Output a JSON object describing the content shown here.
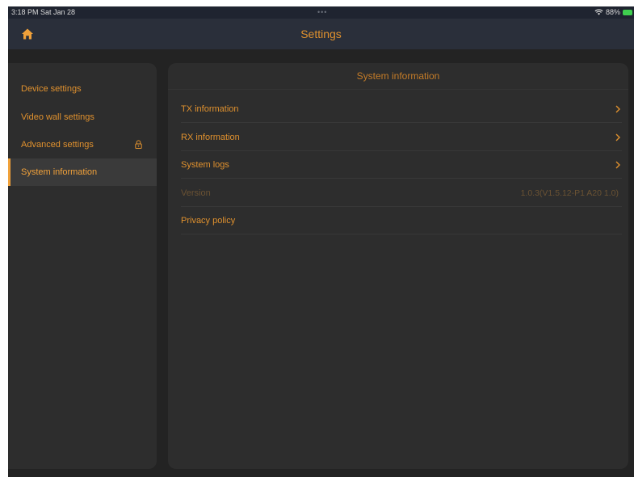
{
  "status_bar": {
    "time_date": "3:18 PM  Sat Jan 28",
    "dots": "•••",
    "battery": "88%"
  },
  "nav": {
    "title": "Settings",
    "home_icon": "home-icon"
  },
  "sidebar": {
    "items": [
      {
        "label": "Device settings"
      },
      {
        "label": "Video wall settings"
      },
      {
        "label": "Advanced settings",
        "icon": "lock-icon"
      },
      {
        "label": "System information",
        "active": true
      }
    ]
  },
  "panel": {
    "header": "System information",
    "rows": [
      {
        "label": "TX information",
        "icon": "chevron-right-icon"
      },
      {
        "label": "RX information",
        "icon": "chevron-right-icon"
      },
      {
        "label": "System logs",
        "icon": "chevron-right-icon"
      },
      {
        "label": "Version",
        "value": "1.0.3(V1.5.12-P1 A20 1.0)"
      },
      {
        "label": "Privacy policy"
      }
    ]
  },
  "colors": {
    "accent": "#e0912e",
    "accent_active": "#f0a13a",
    "background": "#232323",
    "panel": "#2d2d2d",
    "navbar": "#2a2f3a"
  }
}
